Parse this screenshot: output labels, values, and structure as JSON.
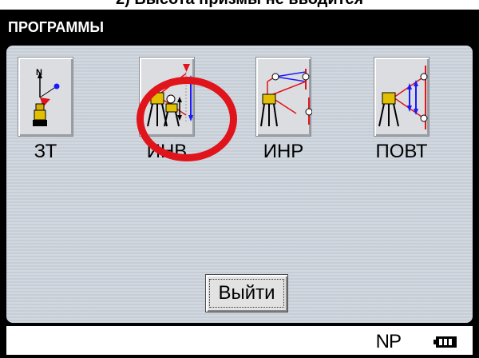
{
  "caption": "2) Высота призмы не вводится",
  "window": {
    "title": "ПРОГРАММЫ"
  },
  "programs": [
    {
      "label": "ЗТ",
      "icon": "north-azimuth-icon"
    },
    {
      "label": "ИНВ",
      "icon": "remote-elevation-icon"
    },
    {
      "label": "ИНР",
      "icon": "missing-line-icon"
    },
    {
      "label": "ПОВТ",
      "icon": "repetition-angle-icon"
    }
  ],
  "exit_button": {
    "label": "Выйти"
  },
  "status": {
    "mode": "NP",
    "battery_icon": "battery-icon"
  },
  "colors": {
    "highlight": "#e0141b",
    "accent_red": "#e0141b",
    "accent_blue": "#1a1aff"
  }
}
